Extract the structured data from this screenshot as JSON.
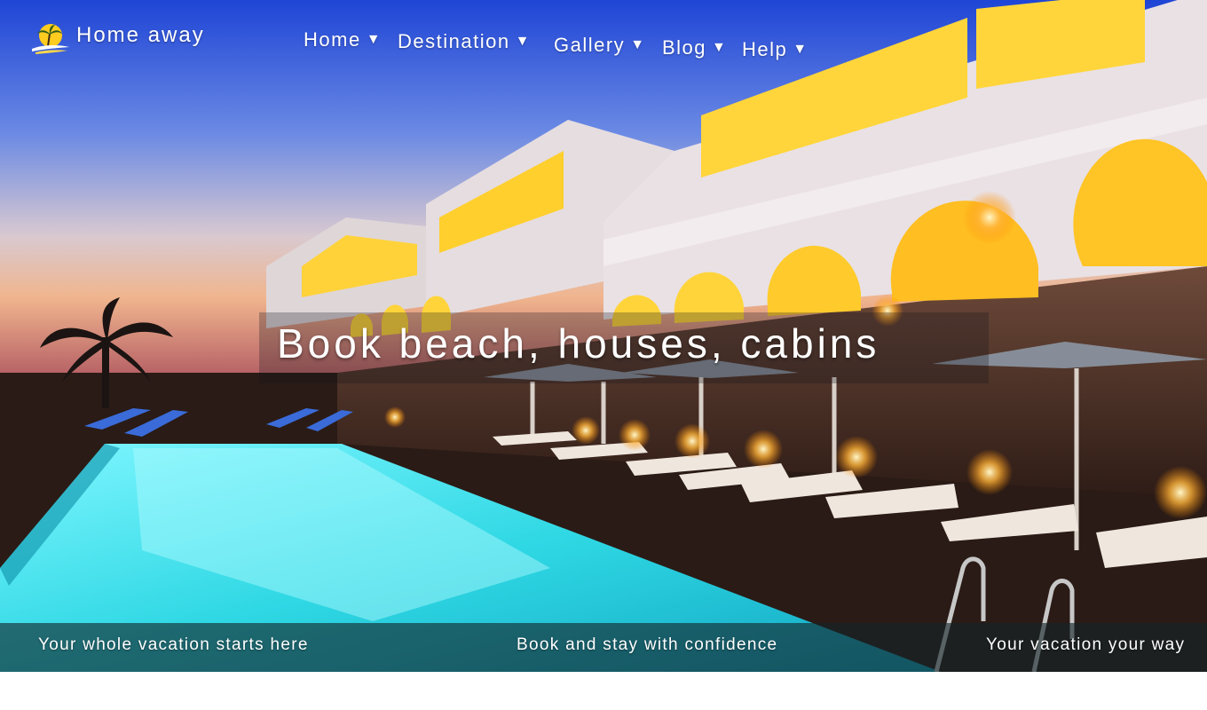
{
  "brand": {
    "name": "Home away"
  },
  "nav": {
    "items": [
      {
        "label": "Home",
        "caret": "▼"
      },
      {
        "label": "Destination",
        "caret": "▼"
      },
      {
        "label": "Gallery",
        "caret": "▼"
      },
      {
        "label": "Blog",
        "caret": "▼"
      },
      {
        "label": "Help",
        "caret": "▼"
      }
    ]
  },
  "hero": {
    "headline": "Book beach, houses, cabins"
  },
  "taglines": [
    "Your whole vacation starts here",
    "Book and stay with confidence",
    "Your vacation your way"
  ],
  "icons": {
    "logo": "palm-island-sun-icon",
    "nav_caret": "caret-down-icon"
  },
  "colors": {
    "pool": "#3ee6ee",
    "window_glow": "#ffd23a",
    "text": "#ffffff"
  }
}
